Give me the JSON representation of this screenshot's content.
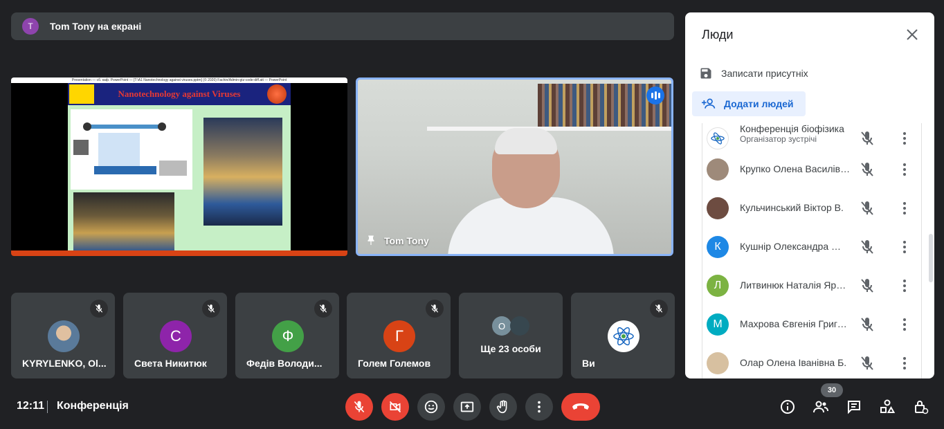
{
  "banner": {
    "avatar_letter": "T",
    "text": "Tom Tony на екрані",
    "avatar_color": "#8e44ad"
  },
  "presentation": {
    "window_title": "Presentation — сб. каф. PowerPoint — [T:\\A1 Nanotechnology against viruses.pptm] (© 2020) Fachin/Admin-gtz-code-diff.att — PowerPoint",
    "slide_title": "Nanotechnology against Viruses"
  },
  "speaker": {
    "name": "Tom Tony",
    "talking_color": "#1a73e8"
  },
  "tiles": [
    {
      "name": "KYRYLENKO, Ol...",
      "avatar_letter": "",
      "avatar_color": "#7a8a6a"
    },
    {
      "name": "Света Никитюк",
      "avatar_letter": "С",
      "avatar_color": "#8e24aa"
    },
    {
      "name": "Федів Володи...",
      "avatar_letter": "Ф",
      "avatar_color": "#43a047"
    },
    {
      "name": "Голем Големов",
      "avatar_letter": "Г",
      "avatar_color": "#d84315"
    },
    {
      "more_text": "Ще 23 особи",
      "avatar_letter": "О"
    },
    {
      "name": "Ви",
      "avatar_letter": "",
      "avatar_color": "#ffffff"
    }
  ],
  "panel": {
    "title": "Люди",
    "record_label": "Записати присутніх",
    "add_label": "Додати людей",
    "people": [
      {
        "name": "Конференція біофізика",
        "role": "Організатор зустрічі",
        "letter": "",
        "color": "#ffffff"
      },
      {
        "name": "Крупко Олена Василівна",
        "letter": "",
        "color": "#9e8a7a"
      },
      {
        "name": "Кульчинський Віктор В.",
        "letter": "",
        "color": "#6d4c41"
      },
      {
        "name": "Кушнір Олександра Юріївна",
        "letter": "К",
        "color": "#1e88e5"
      },
      {
        "name": "Литвинюк Наталія Ярославівна",
        "letter": "Л",
        "color": "#7cb342"
      },
      {
        "name": "Махрова Євгенія Григорівна",
        "letter": "М",
        "color": "#00acc1"
      },
      {
        "name": "Олар Олена Іванівна Б.",
        "letter": "",
        "color": "#d7c0a0"
      }
    ]
  },
  "bottom": {
    "time": "12:11",
    "meeting": "Конференція",
    "people_count": "30",
    "accent_red": "#ea4335"
  }
}
